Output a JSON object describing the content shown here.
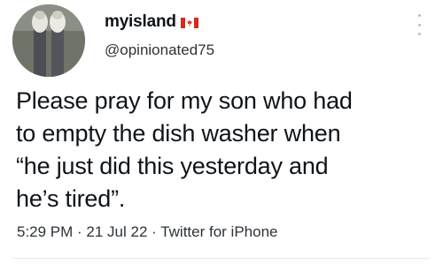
{
  "author": {
    "display_name": "myisland",
    "flag": "canada-flag",
    "handle": "@opinionated75"
  },
  "tweet": {
    "text_lines": [
      "Please pray for my son who had",
      "to empty the dish washer when",
      "“he just did this yesterday and",
      "he’s tired”."
    ],
    "meta": "5:29 PM · 21 Jul 22 · Twitter for iPhone"
  },
  "colors": {
    "text": "#0f1419",
    "secondary": "#2d3338",
    "flag_red": "#d52b1e"
  }
}
